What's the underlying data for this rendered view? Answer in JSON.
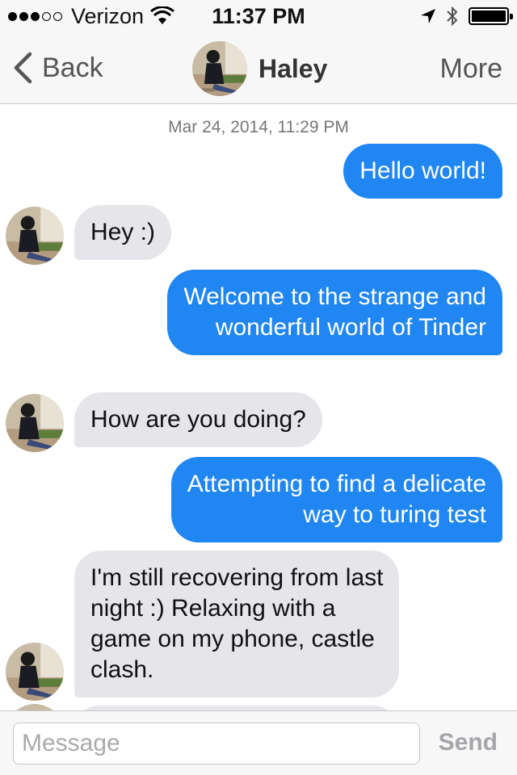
{
  "status_bar": {
    "carrier": "Verizon",
    "time": "11:37 PM",
    "signal_bars_filled": 3,
    "signal_bars_total": 5,
    "battery_level": 1.0
  },
  "nav": {
    "back_label": "Back",
    "title": "Haley",
    "more_label": "More"
  },
  "conversation": {
    "timestamp": "Mar 24, 2014, 11:29 PM",
    "messages": [
      {
        "from": "me",
        "text": "Hello world!"
      },
      {
        "from": "them",
        "text": "Hey :)"
      },
      {
        "from": "me",
        "lines": [
          "Welcome to the strange and",
          "wonderful world of Tinder"
        ]
      },
      {
        "from": "them",
        "text": "How are you doing?"
      },
      {
        "from": "me",
        "lines": [
          "Attempting to find a delicate",
          "way to turing test"
        ]
      },
      {
        "from": "them",
        "lines": [
          "I'm still recovering from last",
          "night :) Relaxing with a",
          "game on my phone, castle",
          "clash."
        ]
      }
    ]
  },
  "composer": {
    "placeholder": "Message",
    "value": "",
    "send_label": "Send"
  },
  "colors": {
    "outgoing_bubble": "#1f86f2",
    "incoming_bubble": "#e5e5ea",
    "bar_background": "#f7f7f7"
  }
}
